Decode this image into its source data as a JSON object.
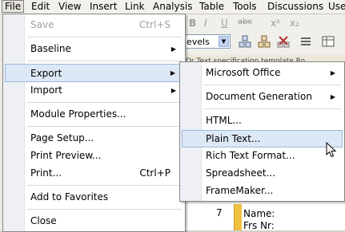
{
  "menubar": {
    "items": [
      "File",
      "Edit",
      "View",
      "Insert",
      "Link",
      "Analysis",
      "Table",
      "Tools",
      "Discussions",
      "User"
    ]
  },
  "toolbar": {
    "levels_combo": "evels",
    "format_glyphs": [
      "B",
      "I",
      "U",
      "abc",
      "x²",
      "x₂"
    ]
  },
  "grid": {
    "col_header": "Dr  Text specification template Ro",
    "row_number": "7",
    "cells": [
      "Name:",
      "Frs Nr:"
    ]
  },
  "file_menu": {
    "items": [
      {
        "label": "Save",
        "shortcut": "Ctrl+S",
        "disabled": true
      },
      {
        "label": "Baseline",
        "submenu": "▶"
      },
      {
        "label": "Export",
        "submenu": "▶",
        "highlighted": true
      },
      {
        "label": "Import",
        "submenu": "▶"
      },
      {
        "label": "Module Properties..."
      },
      {
        "label": "Page Setup..."
      },
      {
        "label": "Print Preview..."
      },
      {
        "label": "Print...",
        "shortcut": "Ctrl+P"
      },
      {
        "label": "Add to Favorites"
      },
      {
        "label": "Close"
      }
    ]
  },
  "export_menu": {
    "items": [
      {
        "label": "Microsoft Office",
        "submenu": "▶"
      },
      {
        "label": "Document Generation",
        "submenu": "▶"
      },
      {
        "label": "HTML..."
      },
      {
        "label": "Plain Text...",
        "highlighted": true
      },
      {
        "label": "Rich Text Format..."
      },
      {
        "label": "Spreadsheet..."
      },
      {
        "label": "FrameMaker..."
      }
    ]
  },
  "colors": {
    "highlight_bg": "#dde8f6",
    "highlight_border": "#9ab8dc",
    "menu_gutter": "#eef0f5"
  }
}
